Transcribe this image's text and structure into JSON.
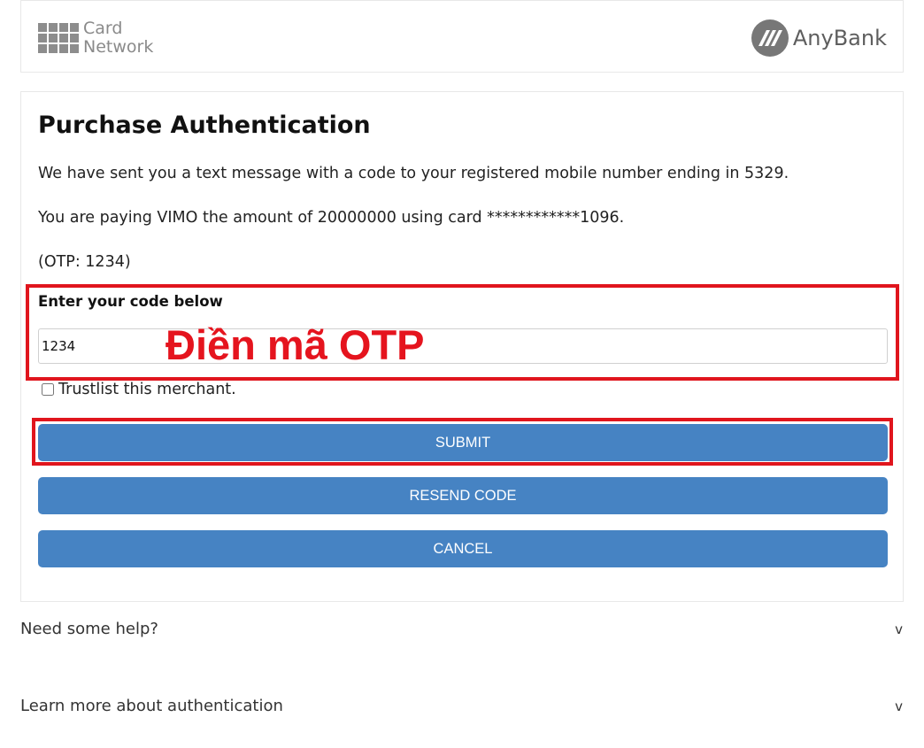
{
  "header": {
    "card_network_logo": {
      "line1": "Card",
      "line2": "Network"
    },
    "bank_logo": {
      "name": "AnyBank"
    }
  },
  "auth": {
    "title": "Purchase Authentication",
    "message_sent": "We have sent you a text message with a code to your registered mobile number ending in 5329.",
    "paying_info": "You are paying VIMO the amount of 20000000 using card ************1096.",
    "otp_hint": "(OTP: 1234)",
    "code_label": "Enter your code below",
    "code_value": "1234",
    "overlay_annotation": "Điền mã OTP",
    "trustlist_label": "Trustlist this merchant.",
    "trustlist_checked": false,
    "submit_label": "SUBMIT",
    "resend_label": "RESEND CODE",
    "cancel_label": "CANCEL"
  },
  "help": {
    "need_help": "Need some help?",
    "learn_more": "Learn more about authentication",
    "chevron": "v"
  },
  "colors": {
    "button": "#4683c3",
    "highlight": "#e0151d",
    "annotation": "#e5141e"
  }
}
